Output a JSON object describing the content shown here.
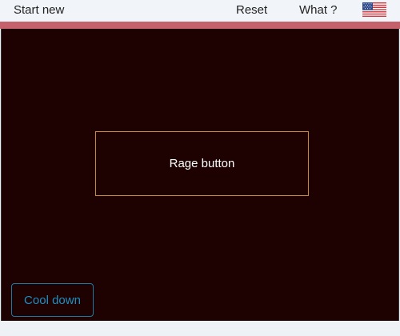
{
  "topbar": {
    "start_new_label": "Start new",
    "reset_label": "Reset",
    "what_label": "What ?",
    "language_icon": "us-flag-icon"
  },
  "colors": {
    "accent_strip": "#c4616b",
    "game_background": "#1e0202",
    "rage_border": "#c8893a",
    "cooldown_accent": "#1f8fc0"
  },
  "game": {
    "rage_button_label": "Rage button",
    "cooldown_button_label": "Cool down"
  }
}
